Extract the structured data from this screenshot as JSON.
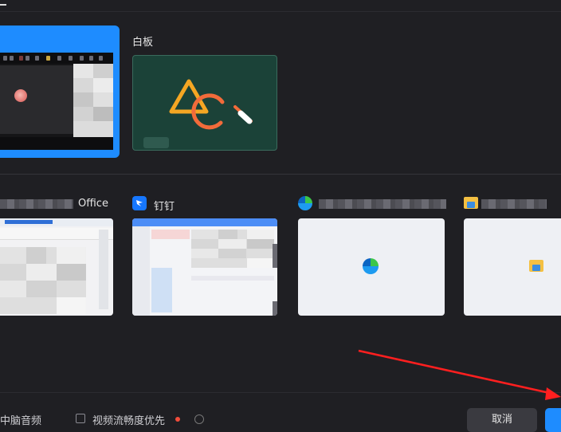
{
  "whiteboard": {
    "label": "白板"
  },
  "apps": [
    {
      "label": "Office",
      "icon": "wps-office-icon"
    },
    {
      "label": "钉钉",
      "icon": "dingtalk-icon"
    },
    {
      "label": "",
      "icon": "edge-icon"
    },
    {
      "label": "",
      "icon": "folder-icon"
    }
  ],
  "bottom": {
    "option1_label": "中脑音频",
    "option2_label": "视频流畅度优先",
    "cancel_label": "取消"
  },
  "colors": {
    "accent": "#1e8cff",
    "arrow": "#ff1f1f",
    "whiteboard_bg": "#1b4238"
  }
}
